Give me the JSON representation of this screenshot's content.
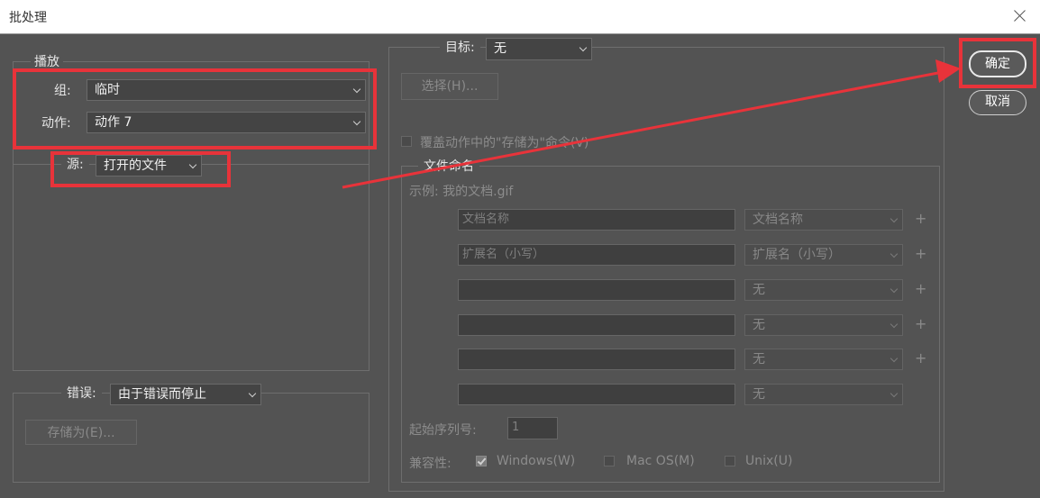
{
  "window": {
    "title": "批处理"
  },
  "play": {
    "legend": "播放",
    "set_label": "组:",
    "set_value": "临时",
    "action_label": "动作:",
    "action_value": "动作 7",
    "source_label": "源:",
    "source_value": "打开的文件"
  },
  "errors": {
    "label": "错误:",
    "value": "由于错误而停止",
    "save_as_button": "存储为(E)..."
  },
  "destination": {
    "label": "目标:",
    "value": "无",
    "choose_button": "选择(H)...",
    "override_checkbox": "覆盖动作中的\"存储为\"命令(V)"
  },
  "file_naming": {
    "legend": "文件命名",
    "example": "示例: 我的文档.gif",
    "rows": [
      {
        "field": "文档名称",
        "select": "文档名称",
        "plus": "+"
      },
      {
        "field": "扩展名（小写）",
        "select": "扩展名（小写）",
        "plus": "+"
      },
      {
        "field": "",
        "select": "无",
        "plus": "+"
      },
      {
        "field": "",
        "select": "无",
        "plus": "+"
      },
      {
        "field": "",
        "select": "无",
        "plus": "+"
      },
      {
        "field": "",
        "select": "无",
        "plus": ""
      }
    ],
    "start_serial_label": "起始序列号:",
    "start_serial_value": "1",
    "compat_label": "兼容性:",
    "windows": "Windows(W)",
    "macos": "Mac OS(M)",
    "unix": "Unix(U)",
    "windows_checked": true,
    "macos_checked": false,
    "unix_checked": false
  },
  "buttons": {
    "ok": "确定",
    "cancel": "取消"
  },
  "annotation": {
    "color": "#e8333a"
  }
}
